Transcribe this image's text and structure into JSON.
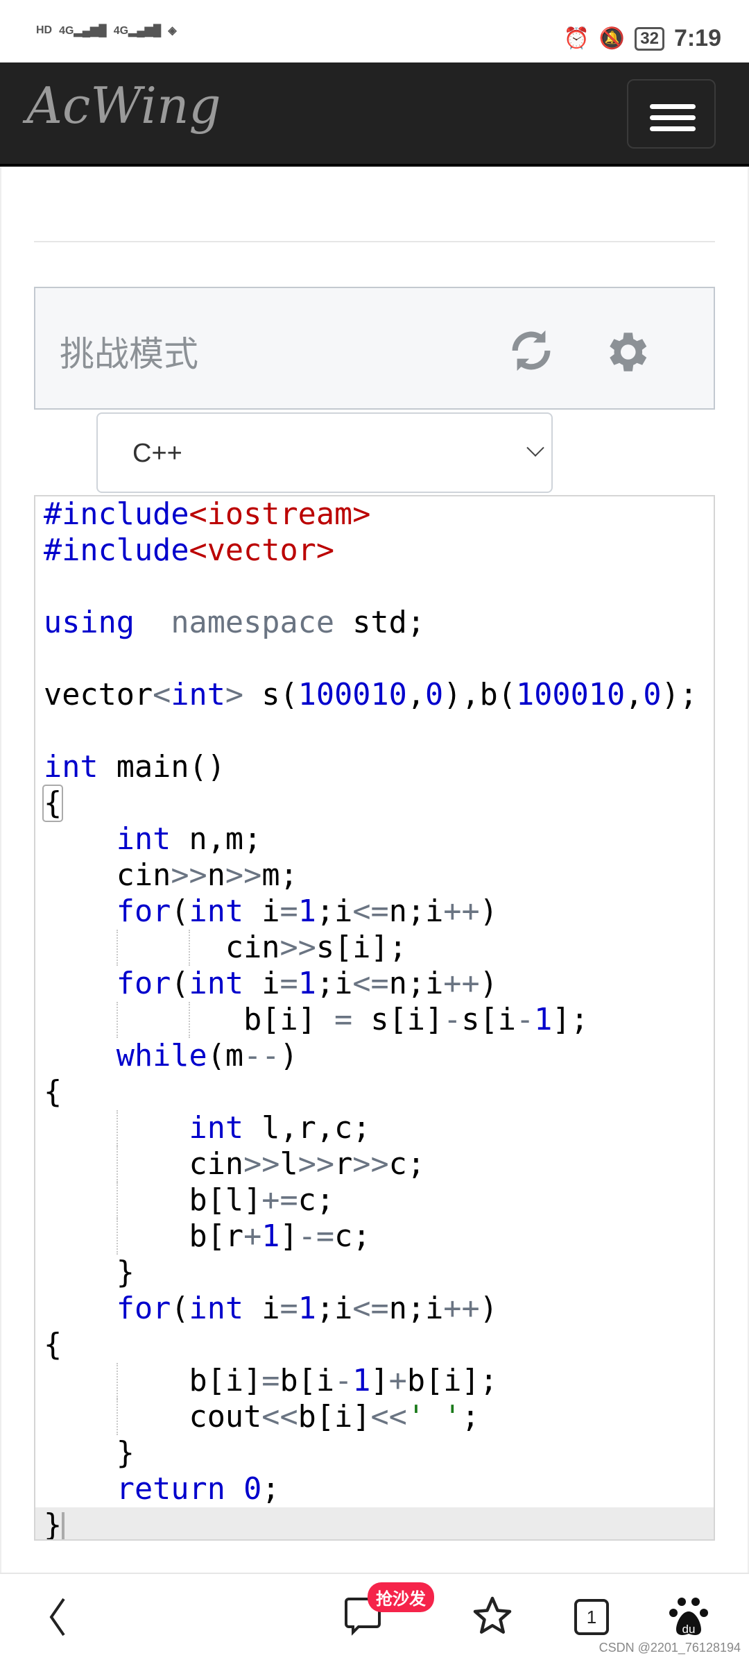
{
  "status_bar": {
    "left_icons": [
      "hd-icon",
      "signal-4g-icon",
      "signal-4g-icon",
      "wifi-icon"
    ],
    "battery": "32",
    "time": "7:19"
  },
  "header": {
    "logo": "AcWing",
    "menu_icon": "hamburger-icon"
  },
  "challenge": {
    "title": "挑战模式",
    "refresh_icon": "refresh-icon",
    "settings_icon": "gear-icon"
  },
  "language_select": {
    "value": "C++"
  },
  "code": {
    "active_line": 29,
    "lines": [
      [
        [
          "meta",
          "#include"
        ],
        [
          "header",
          "<iostream>"
        ]
      ],
      [
        [
          "meta",
          "#include"
        ],
        [
          "header",
          "<vector>"
        ]
      ],
      [],
      [
        [
          "kw",
          "using"
        ],
        [
          "",
          "  "
        ],
        [
          "var",
          "namespace"
        ],
        [
          "",
          " std;"
        ]
      ],
      [],
      [
        [
          "",
          "vector"
        ],
        [
          "op",
          "<"
        ],
        [
          "kw",
          "int"
        ],
        [
          "op",
          ">"
        ],
        [
          "",
          " s("
        ],
        [
          "num",
          "100010"
        ],
        [
          "",
          ","
        ],
        [
          "num",
          "0"
        ],
        [
          "",
          "),b("
        ],
        [
          "num",
          "100010"
        ],
        [
          "",
          ","
        ],
        [
          "num",
          "0"
        ],
        [
          "",
          ");"
        ]
      ],
      [],
      [
        [
          "kw",
          "int"
        ],
        [
          "",
          " main()"
        ]
      ],
      [
        [
          "bracket",
          "{"
        ]
      ],
      [
        [
          "",
          "    "
        ],
        [
          "kw",
          "int"
        ],
        [
          "",
          " n,m;"
        ]
      ],
      [
        [
          "",
          "    cin"
        ],
        [
          "op",
          ">>"
        ],
        [
          "",
          "n"
        ],
        [
          "op",
          ">>"
        ],
        [
          "",
          "m;"
        ]
      ],
      [
        [
          "",
          "    "
        ],
        [
          "kw",
          "for"
        ],
        [
          "",
          "("
        ],
        [
          "kw",
          "int"
        ],
        [
          "",
          " i"
        ],
        [
          "op",
          "="
        ],
        [
          "num",
          "1"
        ],
        [
          "",
          ";i"
        ],
        [
          "op",
          "<="
        ],
        [
          "",
          "n;i"
        ],
        [
          "op",
          "++"
        ],
        [
          "",
          ")"
        ]
      ],
      [
        [
          "",
          "          cin"
        ],
        [
          "op",
          ">>"
        ],
        [
          "",
          "s[i];"
        ]
      ],
      [
        [
          "",
          "    "
        ],
        [
          "kw",
          "for"
        ],
        [
          "",
          "("
        ],
        [
          "kw",
          "int"
        ],
        [
          "",
          " i"
        ],
        [
          "op",
          "="
        ],
        [
          "num",
          "1"
        ],
        [
          "",
          ";i"
        ],
        [
          "op",
          "<="
        ],
        [
          "",
          "n;i"
        ],
        [
          "op",
          "++"
        ],
        [
          "",
          ")"
        ]
      ],
      [
        [
          "",
          "           b[i] "
        ],
        [
          "op",
          "="
        ],
        [
          "",
          " s[i]"
        ],
        [
          "op",
          "-"
        ],
        [
          "",
          "s[i"
        ],
        [
          "op",
          "-"
        ],
        [
          "num",
          "1"
        ],
        [
          "",
          "];"
        ]
      ],
      [
        [
          "",
          "    "
        ],
        [
          "kw",
          "while"
        ],
        [
          "",
          "(m"
        ],
        [
          "op",
          "--"
        ],
        [
          "",
          ")"
        ]
      ],
      [
        [
          "",
          "{"
        ]
      ],
      [
        [
          "",
          "        "
        ],
        [
          "kw",
          "int"
        ],
        [
          "",
          " l,r,c;"
        ]
      ],
      [
        [
          "",
          "        cin"
        ],
        [
          "op",
          ">>"
        ],
        [
          "",
          "l"
        ],
        [
          "op",
          ">>"
        ],
        [
          "",
          "r"
        ],
        [
          "op",
          ">>"
        ],
        [
          "",
          "c;"
        ]
      ],
      [
        [
          "",
          "        b[l]"
        ],
        [
          "op",
          "+="
        ],
        [
          "",
          "c;"
        ]
      ],
      [
        [
          "",
          "        b[r"
        ],
        [
          "op",
          "+"
        ],
        [
          "num",
          "1"
        ],
        [
          "",
          "]"
        ],
        [
          "op",
          "-="
        ],
        [
          "",
          "c;"
        ]
      ],
      [
        [
          "",
          "    }"
        ]
      ],
      [
        [
          "",
          "    "
        ],
        [
          "kw",
          "for"
        ],
        [
          "",
          "("
        ],
        [
          "kw",
          "int"
        ],
        [
          "",
          " i"
        ],
        [
          "op",
          "="
        ],
        [
          "num",
          "1"
        ],
        [
          "",
          ";i"
        ],
        [
          "op",
          "<="
        ],
        [
          "",
          "n;i"
        ],
        [
          "op",
          "++"
        ],
        [
          "",
          ")"
        ]
      ],
      [
        [
          "",
          "{"
        ]
      ],
      [
        [
          "",
          "        b[i]"
        ],
        [
          "op",
          "="
        ],
        [
          "",
          "b[i"
        ],
        [
          "op",
          "-"
        ],
        [
          "num",
          "1"
        ],
        [
          "",
          "]"
        ],
        [
          "op",
          "+"
        ],
        [
          "",
          "b[i];"
        ]
      ],
      [
        [
          "",
          "        cout"
        ],
        [
          "op",
          "<<"
        ],
        [
          "",
          "b[i]"
        ],
        [
          "op",
          "<<"
        ],
        [
          "str",
          "' '"
        ],
        [
          "",
          ";"
        ]
      ],
      [
        [
          "",
          "    }"
        ]
      ],
      [
        [
          "",
          "    "
        ],
        [
          "kw",
          "return"
        ],
        [
          "",
          " "
        ],
        [
          "num",
          "0"
        ],
        [
          "",
          ";"
        ]
      ],
      [
        [
          "",
          "}"
        ]
      ]
    ]
  },
  "bottom_bar": {
    "badge": "抢沙发",
    "tab_count": "1",
    "watermark": "CSDN @2201_76128194"
  }
}
